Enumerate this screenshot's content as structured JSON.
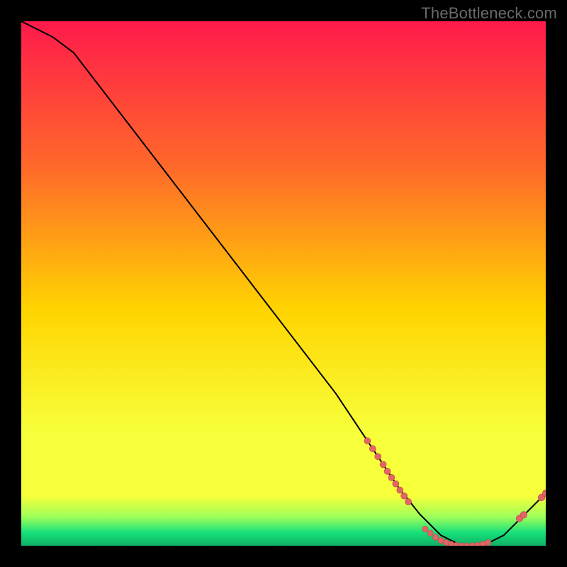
{
  "watermark": "TheBottleneck.com",
  "colors": {
    "black": "#000000",
    "line": "#000000",
    "dot_fill": "#e06666",
    "dot_stroke": "#c04747",
    "grad_top": "#ff1a4b",
    "grad_mid_upper": "#ff6a2a",
    "grad_mid": "#ffd400",
    "grad_mid_lower": "#f7ff3a",
    "grad_green_top": "#9dff5a",
    "grad_green": "#18e07a",
    "grad_green_deep": "#0fb066"
  },
  "chart_data": {
    "type": "line",
    "title": "",
    "xlabel": "",
    "ylabel": "",
    "xlim": [
      0,
      100
    ],
    "ylim": [
      0,
      100
    ],
    "series": [
      {
        "name": "bottleneck-curve",
        "x": [
          0,
          6,
          10,
          20,
          30,
          40,
          50,
          60,
          68,
          72,
          76,
          80,
          84,
          88,
          92,
          96,
          100
        ],
        "y": [
          100,
          97,
          94,
          81,
          68,
          55,
          42,
          29,
          17,
          11,
          6,
          2,
          0,
          0,
          2,
          6,
          10
        ]
      }
    ],
    "dots_cluster_a": {
      "name": "cluster-descent",
      "points": [
        {
          "x": 66,
          "y": 20
        },
        {
          "x": 67,
          "y": 18.5
        },
        {
          "x": 68,
          "y": 17
        },
        {
          "x": 69,
          "y": 15.5
        },
        {
          "x": 69.8,
          "y": 14.2
        },
        {
          "x": 70.6,
          "y": 13
        },
        {
          "x": 71.4,
          "y": 11.8
        },
        {
          "x": 72.2,
          "y": 10.6
        },
        {
          "x": 73,
          "y": 9.5
        },
        {
          "x": 73.8,
          "y": 8.4
        }
      ]
    },
    "dots_cluster_b": {
      "name": "cluster-valley",
      "points": [
        {
          "x": 77,
          "y": 3.2
        },
        {
          "x": 78,
          "y": 2.4
        },
        {
          "x": 79,
          "y": 1.6
        },
        {
          "x": 80,
          "y": 1.0
        },
        {
          "x": 81,
          "y": 0.6
        },
        {
          "x": 82,
          "y": 0.3
        },
        {
          "x": 83,
          "y": 0.1
        },
        {
          "x": 84,
          "y": 0.0
        },
        {
          "x": 85,
          "y": 0.0
        },
        {
          "x": 86,
          "y": 0.0
        },
        {
          "x": 87,
          "y": 0.1
        },
        {
          "x": 88,
          "y": 0.3
        },
        {
          "x": 89,
          "y": 0.6
        }
      ]
    },
    "dots_cluster_c": {
      "name": "cluster-rise",
      "points": [
        {
          "x": 95,
          "y": 5.2
        },
        {
          "x": 95.8,
          "y": 5.9
        },
        {
          "x": 99.2,
          "y": 9.2
        },
        {
          "x": 100,
          "y": 10.0
        }
      ]
    }
  }
}
